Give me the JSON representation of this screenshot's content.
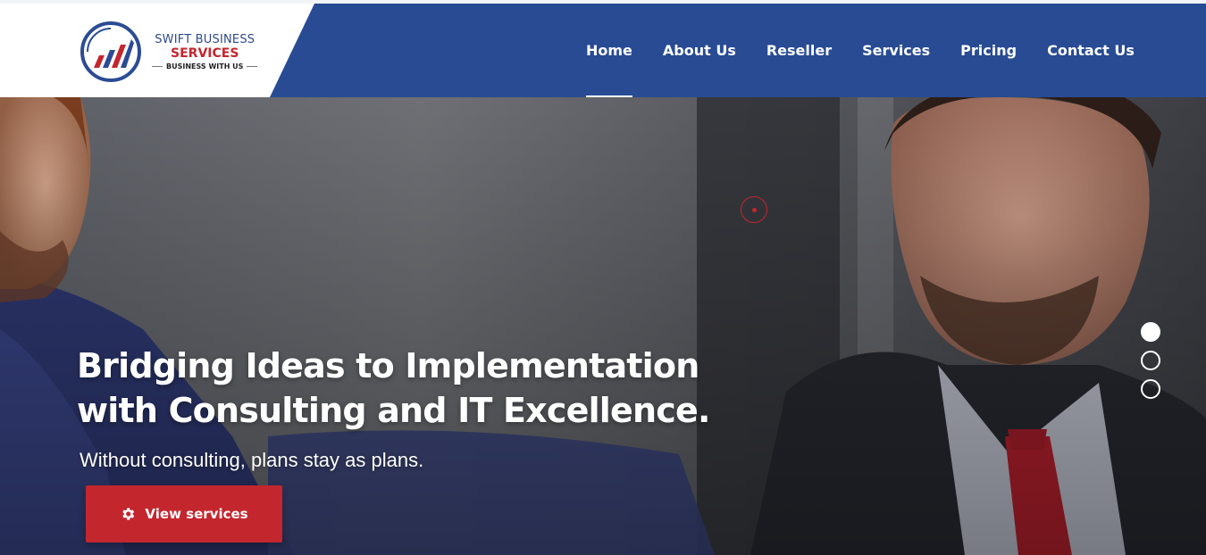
{
  "logo": {
    "line1": "SWIFT BUSINESS",
    "line2": "SERVICES",
    "line3": "BUSINESS WITH US"
  },
  "nav": {
    "items": [
      {
        "label": "Home",
        "active": true
      },
      {
        "label": "About Us",
        "active": false
      },
      {
        "label": "Reseller",
        "active": false
      },
      {
        "label": "Services",
        "active": false
      },
      {
        "label": "Pricing",
        "active": false
      },
      {
        "label": "Contact Us",
        "active": false
      }
    ]
  },
  "hero": {
    "headline_line1": "Bridging Ideas to Implementation",
    "headline_line2": "with Consulting and IT Excellence.",
    "subtitle": "Without consulting, plans stay as plans.",
    "cta_label": "View services",
    "cta_icon": "gear-icon",
    "slides_total": 3,
    "active_slide": 1
  },
  "colors": {
    "brand_blue": "#284b94",
    "accent_red": "#c4262e",
    "white": "#ffffff"
  }
}
